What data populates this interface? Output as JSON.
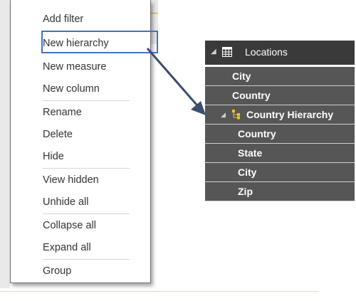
{
  "context_menu": {
    "items": [
      {
        "label": "Add filter"
      },
      {
        "label": "New hierarchy"
      },
      {
        "label": "New measure"
      },
      {
        "label": "New column"
      },
      {
        "label": "Rename"
      },
      {
        "label": "Delete"
      },
      {
        "label": "Hide"
      },
      {
        "label": "View hidden"
      },
      {
        "label": "Unhide all"
      },
      {
        "label": "Collapse all"
      },
      {
        "label": "Expand all"
      },
      {
        "label": "Group"
      }
    ],
    "highlighted_item": "New hierarchy"
  },
  "fields_panel": {
    "table": {
      "name": "Locations",
      "icon": "table-icon",
      "expand_icon": "caret-down-icon"
    },
    "fields": [
      {
        "label": "City"
      },
      {
        "label": "Country"
      }
    ],
    "hierarchy": {
      "label": "Country Hierarchy",
      "icon": "hierarchy-icon",
      "expand_icon": "caret-down-icon",
      "levels": [
        {
          "label": "Country"
        },
        {
          "label": "State"
        },
        {
          "label": "City"
        },
        {
          "label": "Zip"
        }
      ]
    }
  },
  "colors": {
    "highlight_border": "#4472c4",
    "arrow": "#3b4e6e",
    "panel_header_bg": "#3a3a3a",
    "panel_row_bg": "#565656"
  }
}
